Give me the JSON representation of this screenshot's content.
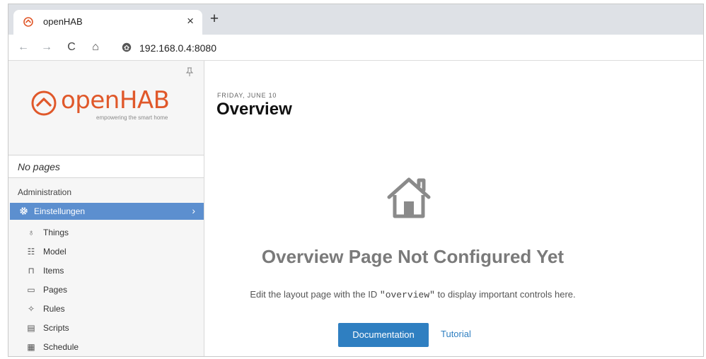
{
  "browser": {
    "tab_title": "openHAB",
    "tab_close": "×",
    "new_tab": "+",
    "url": "192.168.0.4:8080",
    "nav_back": "←",
    "nav_forward": "→",
    "nav_reload": "C",
    "nav_home": "⌂"
  },
  "sidebar": {
    "logo_text_open": "open",
    "logo_text_hab": "HAB",
    "logo_tagline": "empowering the smart home",
    "no_pages": "No pages",
    "admin_title": "Administration",
    "active_item": {
      "label": "Einstellungen",
      "icon": "gear-icon",
      "chevron": "›"
    },
    "items": [
      {
        "label": "Things",
        "icon": "lightbulb-icon",
        "glyph": "♁"
      },
      {
        "label": "Model",
        "icon": "model-icon",
        "glyph": "☷"
      },
      {
        "label": "Items",
        "icon": "items-icon",
        "glyph": "⊓"
      },
      {
        "label": "Pages",
        "icon": "monitor-icon",
        "glyph": "▭"
      },
      {
        "label": "Rules",
        "icon": "rules-icon",
        "glyph": "✧"
      },
      {
        "label": "Scripts",
        "icon": "script-icon",
        "glyph": "▤"
      },
      {
        "label": "Schedule",
        "icon": "calendar-icon",
        "glyph": "▦"
      }
    ]
  },
  "main": {
    "date": "FRIDAY, JUNE 10",
    "title": "Overview",
    "headline": "Overview Page Not Configured Yet",
    "desc_before": "Edit the layout page with the ID ",
    "desc_code": "\"overview\"",
    "desc_after": " to display important controls here.",
    "doc_button": "Documentation",
    "tutorial_link": "Tutorial"
  },
  "colors": {
    "accent": "#2f7fc1",
    "active_item_bg": "#5c8fcf",
    "brand": "#e0582a",
    "headline": "#7a7a7a"
  }
}
